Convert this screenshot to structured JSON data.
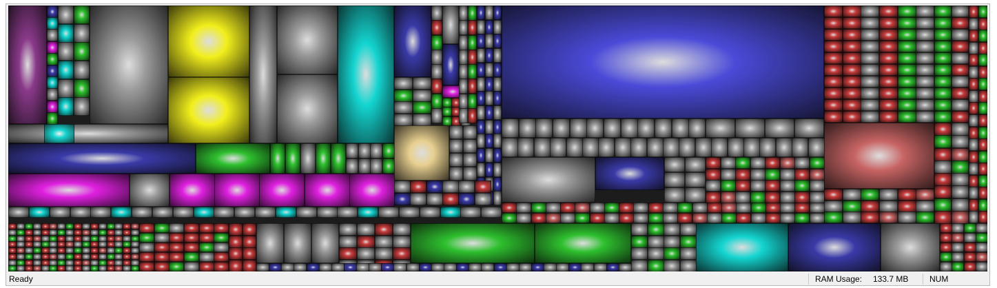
{
  "status": {
    "ready": "Ready",
    "ram_label": "RAM Usage:",
    "ram_value": "133.7 MB",
    "num": "NUM"
  },
  "palette": {
    "gray": "#9a9a9a",
    "yellow": "#f2ef1c",
    "cyan": "#14d5d0",
    "purple": "#8a3a8a",
    "magenta": "#e020e0",
    "blue": "#3a3aa8",
    "deepblue": "#4a4ad8",
    "green": "#2ec02e",
    "red": "#c83c3c",
    "rose": "#c86464",
    "tan": "#e8d090"
  }
}
